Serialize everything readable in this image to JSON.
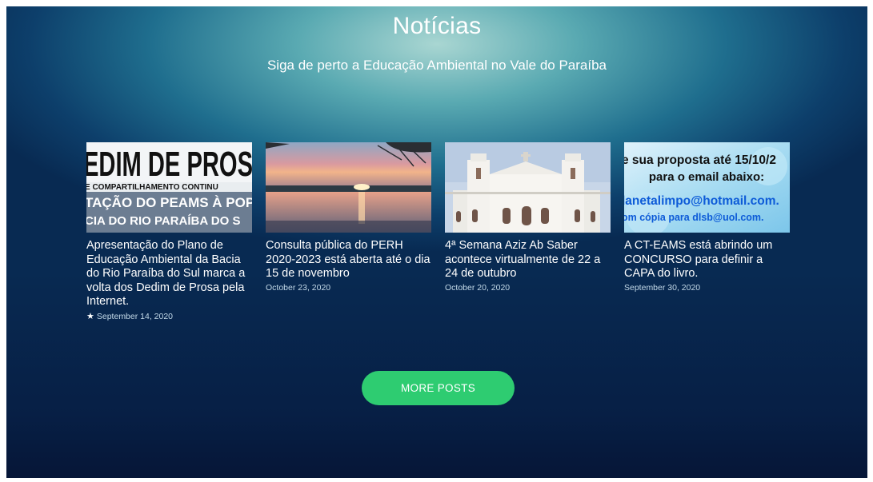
{
  "section": {
    "title": "Notícias",
    "subtitle": "Siga de perto a Educação Ambiental no Vale do Paraíba"
  },
  "posts": [
    {
      "thumb_text": [
        "EDIM DE PROS",
        "E COMPARTILHAMENTO CONTINU",
        "TAÇÃO DO PEAMS À POPU",
        "CIA DO RIO PARAÍBA DO S"
      ],
      "title": "Apresentação do Plano de Educação Ambiental da Bacia do Rio Paraíba do Sul marca a volta dos Dedim de Prosa pela Internet.",
      "date": "September 14, 2020",
      "featured_icon": "star-icon"
    },
    {
      "thumb_text": [],
      "title": "Consulta pública do PERH 2020-2023 está aberta até o dia 15 de novembro",
      "date": "October 23, 2020"
    },
    {
      "thumb_text": [],
      "title": "4ª Semana Aziz Ab Saber acontece virtualmente de 22 a 24 de outubro",
      "date": "October 20, 2020"
    },
    {
      "thumb_text": [
        "e sua proposta até 15/10/2",
        "para o email abaixo:",
        "lanetalimpo@hotmail.com.",
        "om cópia para dlsb@uol.com."
      ],
      "title": "A CT-EAMS está abrindo um CONCURSO para definir a CAPA do livro.",
      "date": "September 30, 2020"
    }
  ],
  "more_button": {
    "label": "MORE POSTS",
    "color": "#2ecc71"
  }
}
